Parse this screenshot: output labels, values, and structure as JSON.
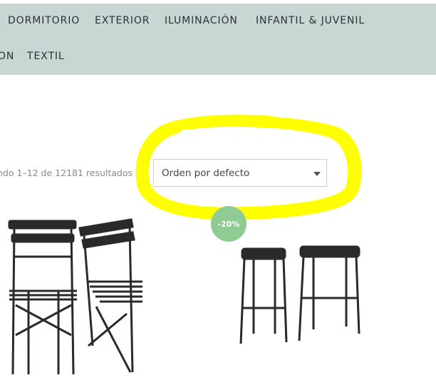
{
  "nav": {
    "row1": [
      "DORMITORIO",
      "EXTERIOR",
      "ILUMINACIÓN",
      "INFANTIL & JUVENIL"
    ],
    "row2": [
      "ON",
      "TEXTIL"
    ]
  },
  "shop": {
    "result_count": "ndo 1–12 de 12181 resultados",
    "orderby_selected": "Orden por defecto"
  },
  "products": [
    {
      "sale_badge": "-20%",
      "image": "folding-chairs-image"
    },
    {
      "image": "bar-stools-image"
    }
  ],
  "colors": {
    "nav_background": "#c8d6d4",
    "highlight": "#ffff00",
    "badge": "#8fcc93"
  }
}
